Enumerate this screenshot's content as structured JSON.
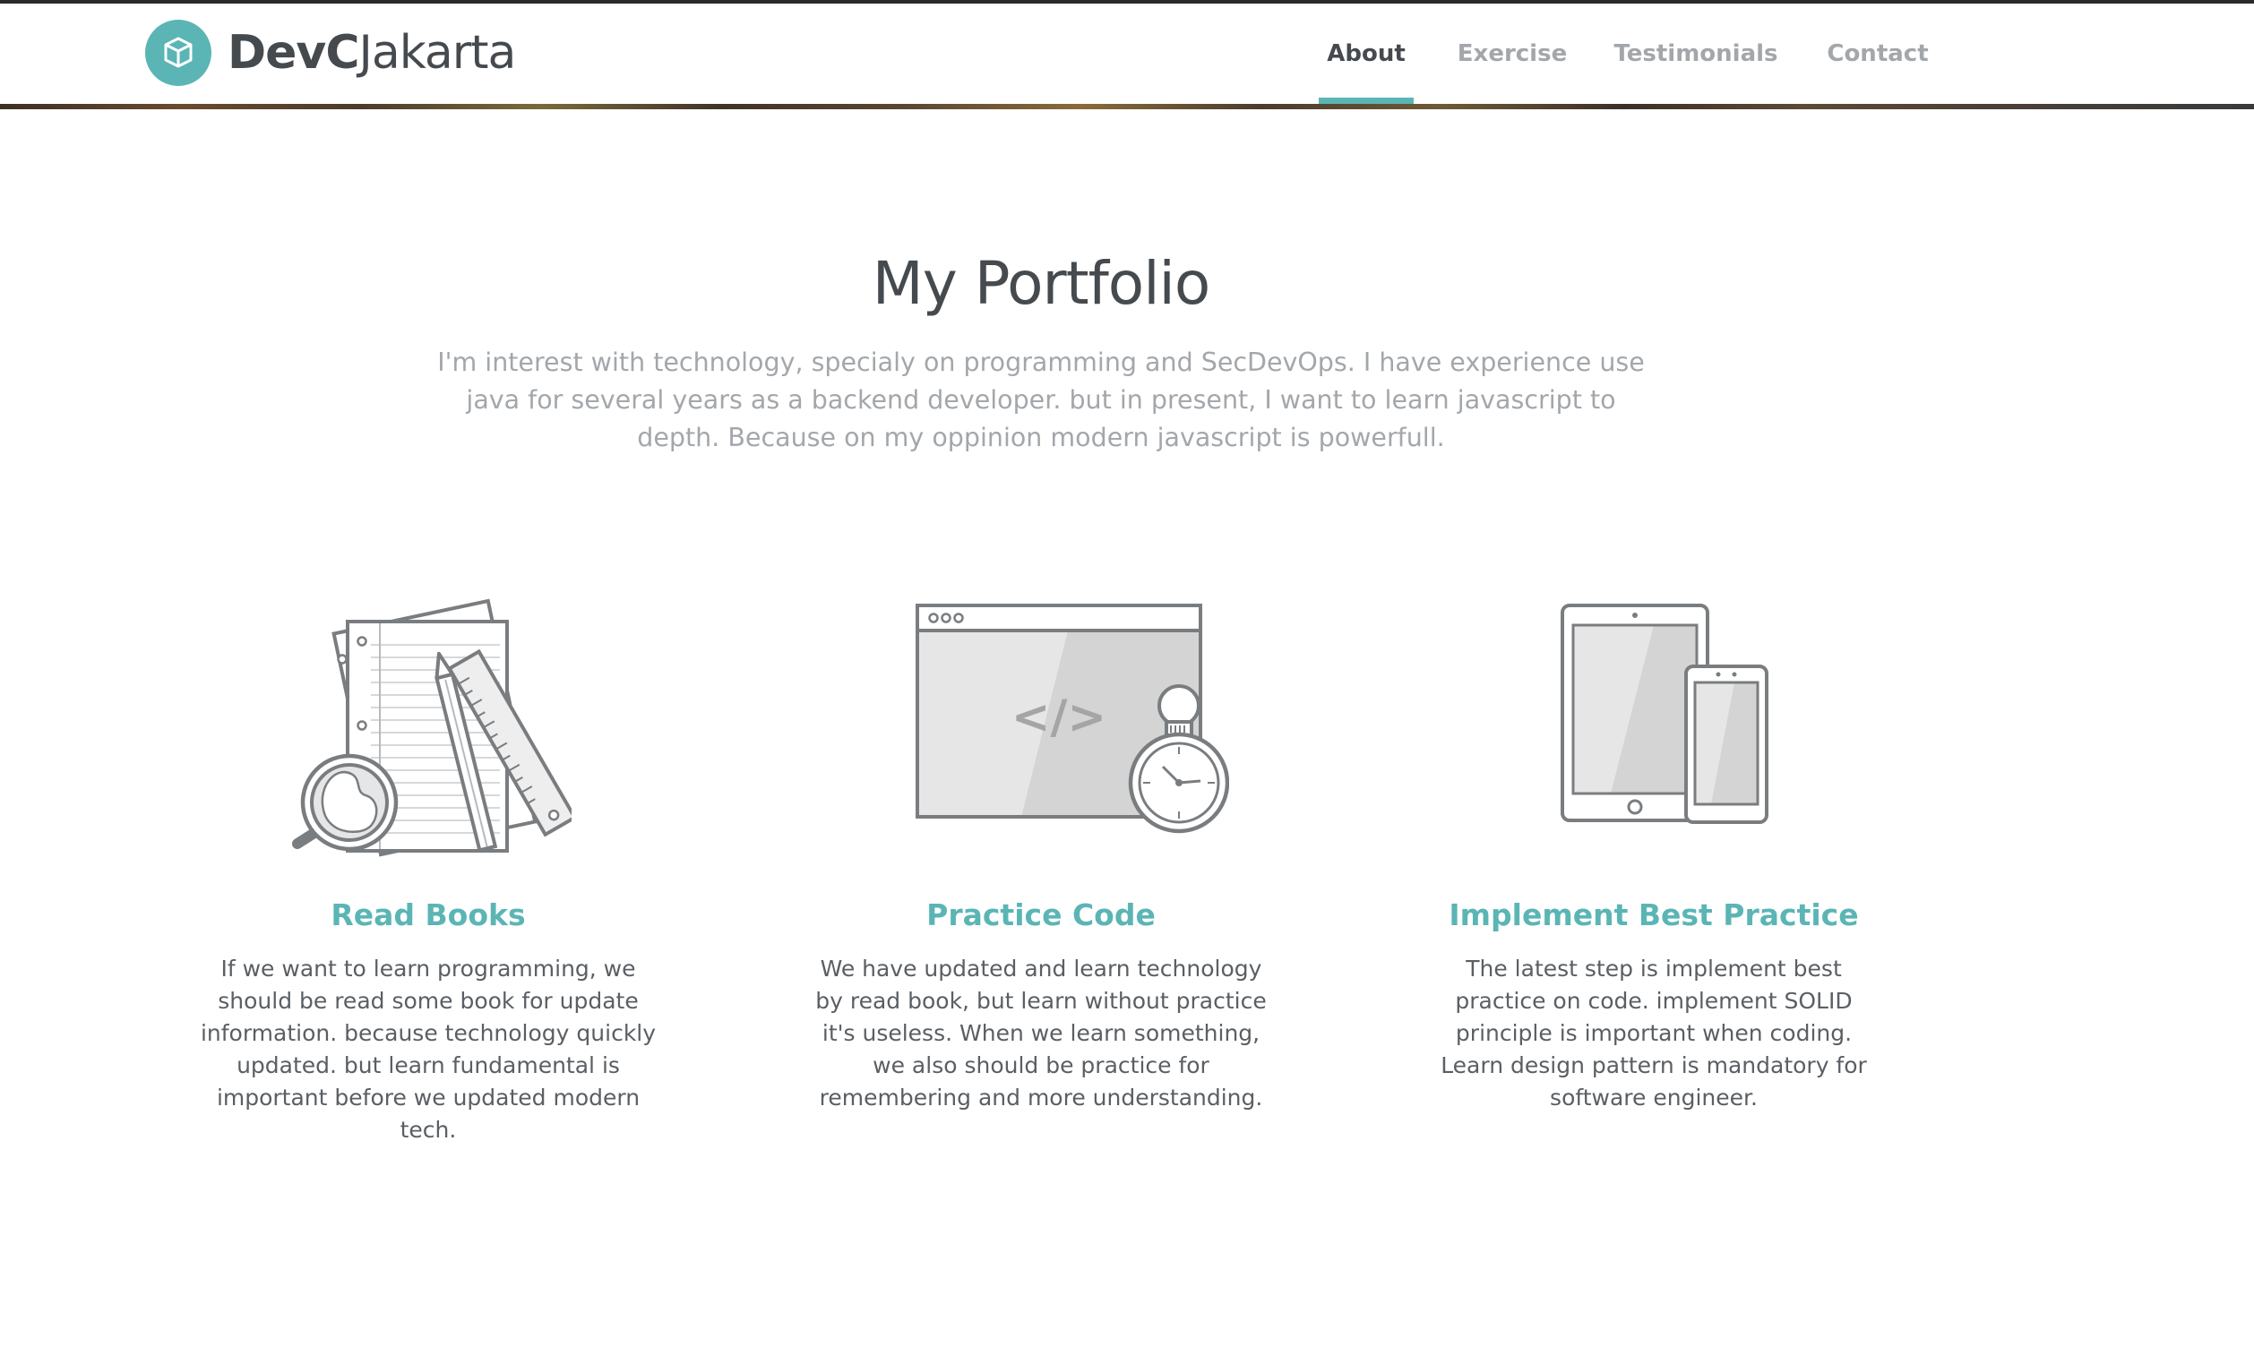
{
  "brand": {
    "name_bold": "DevC",
    "name_light": "Jakarta",
    "logo_icon": "cube-icon",
    "accent_color": "#5bb5b5"
  },
  "nav": {
    "items": [
      {
        "label": "About",
        "active": true
      },
      {
        "label": "Exercise",
        "active": false
      },
      {
        "label": "Testimonials",
        "active": false
      },
      {
        "label": "Contact",
        "active": false
      }
    ]
  },
  "portfolio": {
    "title": "My Portfolio",
    "intro": "I'm interest with technology, specialy on programming and SecDevOps. I have experience use java for several years as a backend developer. but in present, I want to learn javascript to depth. Because on my oppinion modern javascript is powerfull.",
    "cards": [
      {
        "icon": "books-and-tools-icon",
        "title": "Read Books",
        "text": "If we want to learn programming, we should be read some book for update information. because technology quickly updated. but learn fundamental is important before we updated modern tech."
      },
      {
        "icon": "code-browser-stopwatch-icon",
        "title": "Practice Code",
        "text": "We have updated and learn technology by read book, but learn without practice it's useless. When we learn something, we also should be practice for remembering and more understanding."
      },
      {
        "icon": "tablet-phone-icon",
        "title": "Implement Best Practice",
        "text": "The latest step is implement best practice on code. implement SOLID principle is important when coding. Learn design pattern is mandatory for software engineer."
      }
    ]
  }
}
